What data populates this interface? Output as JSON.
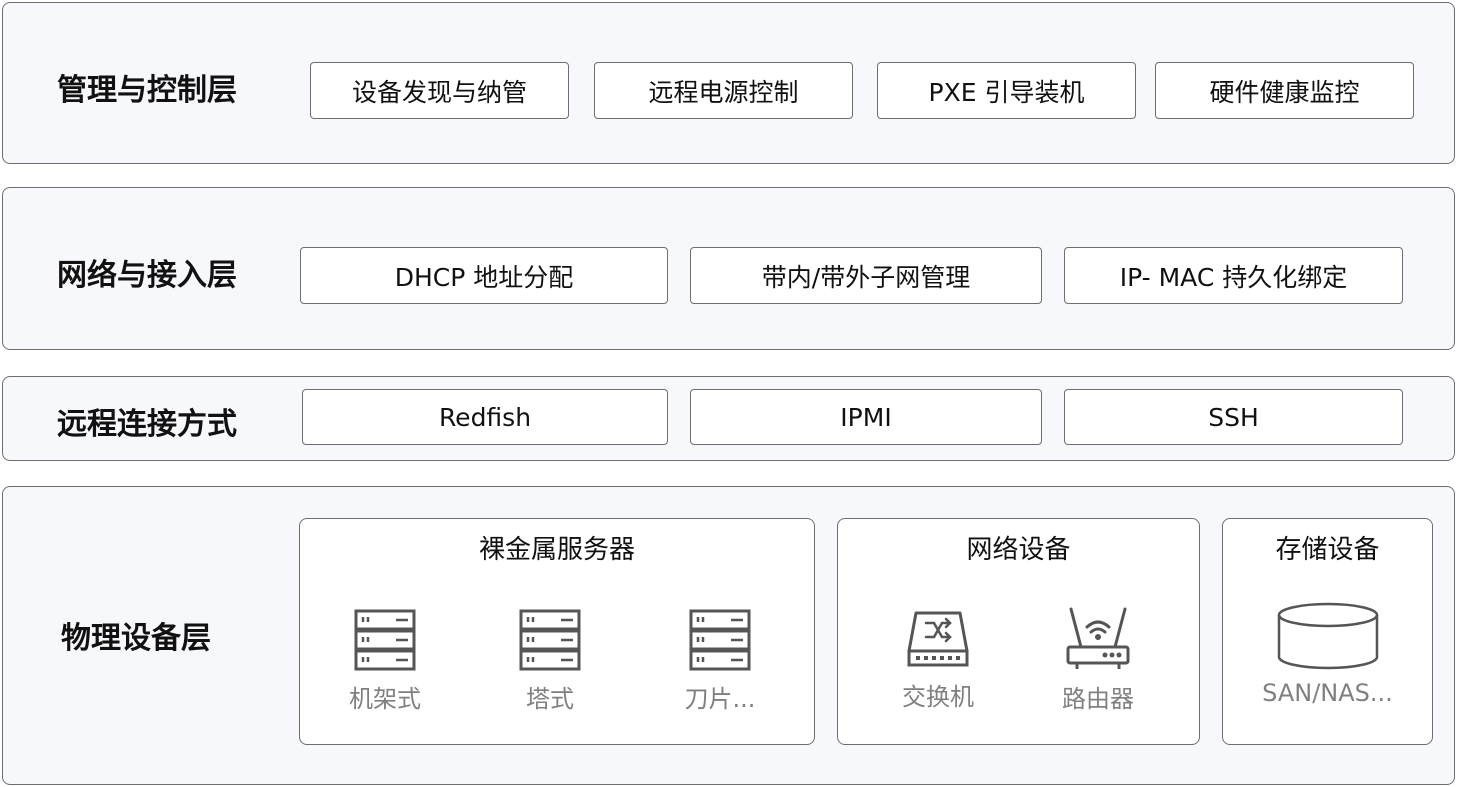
{
  "layers": {
    "management": {
      "title": "管理与控制层",
      "items": [
        "设备发现与纳管",
        "远程电源控制",
        "PXE 引导装机",
        "硬件健康监控"
      ]
    },
    "network": {
      "title": "网络与接入层",
      "items": [
        "DHCP 地址分配",
        "带内/带外子网管理",
        "IP- MAC 持久化绑定"
      ]
    },
    "remote": {
      "title": "远程连接方式",
      "items": [
        "Redfish",
        "IPMI",
        "SSH"
      ]
    },
    "physical": {
      "title": "物理设备层",
      "groups": [
        {
          "title": "裸金属服务器",
          "devices": [
            {
              "label": "机架式",
              "icon": "server-rack-icon"
            },
            {
              "label": "塔式",
              "icon": "server-rack-icon"
            },
            {
              "label": "刀片...",
              "icon": "server-rack-icon"
            }
          ]
        },
        {
          "title": "网络设备",
          "devices": [
            {
              "label": "交换机",
              "icon": "switch-icon"
            },
            {
              "label": "路由器",
              "icon": "router-icon"
            }
          ]
        },
        {
          "title": "存储设备",
          "devices": [
            {
              "label": "SAN/NAS...",
              "icon": "storage-cylinder-icon"
            }
          ]
        }
      ]
    }
  },
  "colors": {
    "layer_bg": "#f7f8fb",
    "border": "#6e6e6e",
    "icon": "#555555",
    "device_label": "#808080"
  }
}
